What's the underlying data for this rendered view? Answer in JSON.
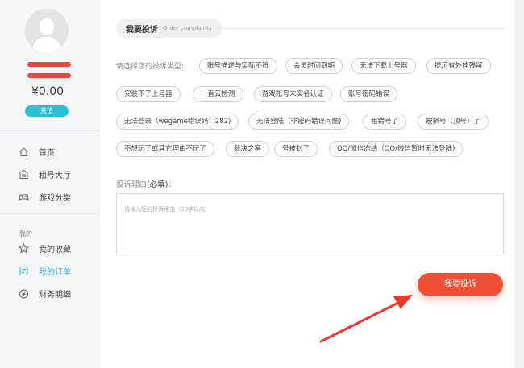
{
  "sidebar": {
    "balance": "¥0.00",
    "recharge_label": "充值",
    "nav_main": [
      {
        "label": "首页",
        "icon": "home-icon"
      },
      {
        "label": "租号大厅",
        "icon": "shop-icon"
      },
      {
        "label": "游戏分类",
        "icon": "gamepad-icon"
      }
    ],
    "section_label": "我的",
    "nav_mine": [
      {
        "label": "我的收藏",
        "icon": "star-icon"
      },
      {
        "label": "我的订单",
        "icon": "order-icon",
        "active": true
      },
      {
        "label": "财务明细",
        "icon": "money-icon"
      }
    ]
  },
  "main": {
    "title": "我要投诉",
    "title_sub": "Order complaints",
    "prompt": "请选择您的投诉类型:",
    "tags": [
      "账号描述与实际不符",
      "会员时间到期",
      "无法下载上号器",
      "提示有外挂残留",
      "安装不了上号器",
      "一直云检测",
      "游戏账号未实名认证",
      "账号密码错误",
      "无法登录（wegame错误码：282)",
      "无法登陆（非密码错误问题)",
      "租错号了",
      "被挤号（顶号）了",
      "不想玩了或其它理由不玩了",
      "裁决之塞",
      "号被封了",
      "QQ/微信冻结（QQ/微信暂时无法登陆)"
    ],
    "reason_label": "投诉理由",
    "reason_required": "(必填)",
    "reason_colon": "：",
    "reason_placeholder": "请输入您的投诉理由（30字以内)",
    "submit_label": "我要投诉"
  },
  "colors": {
    "accent": "#2bbfd6",
    "submit": "#f24e36",
    "arrow": "#e8392b"
  }
}
